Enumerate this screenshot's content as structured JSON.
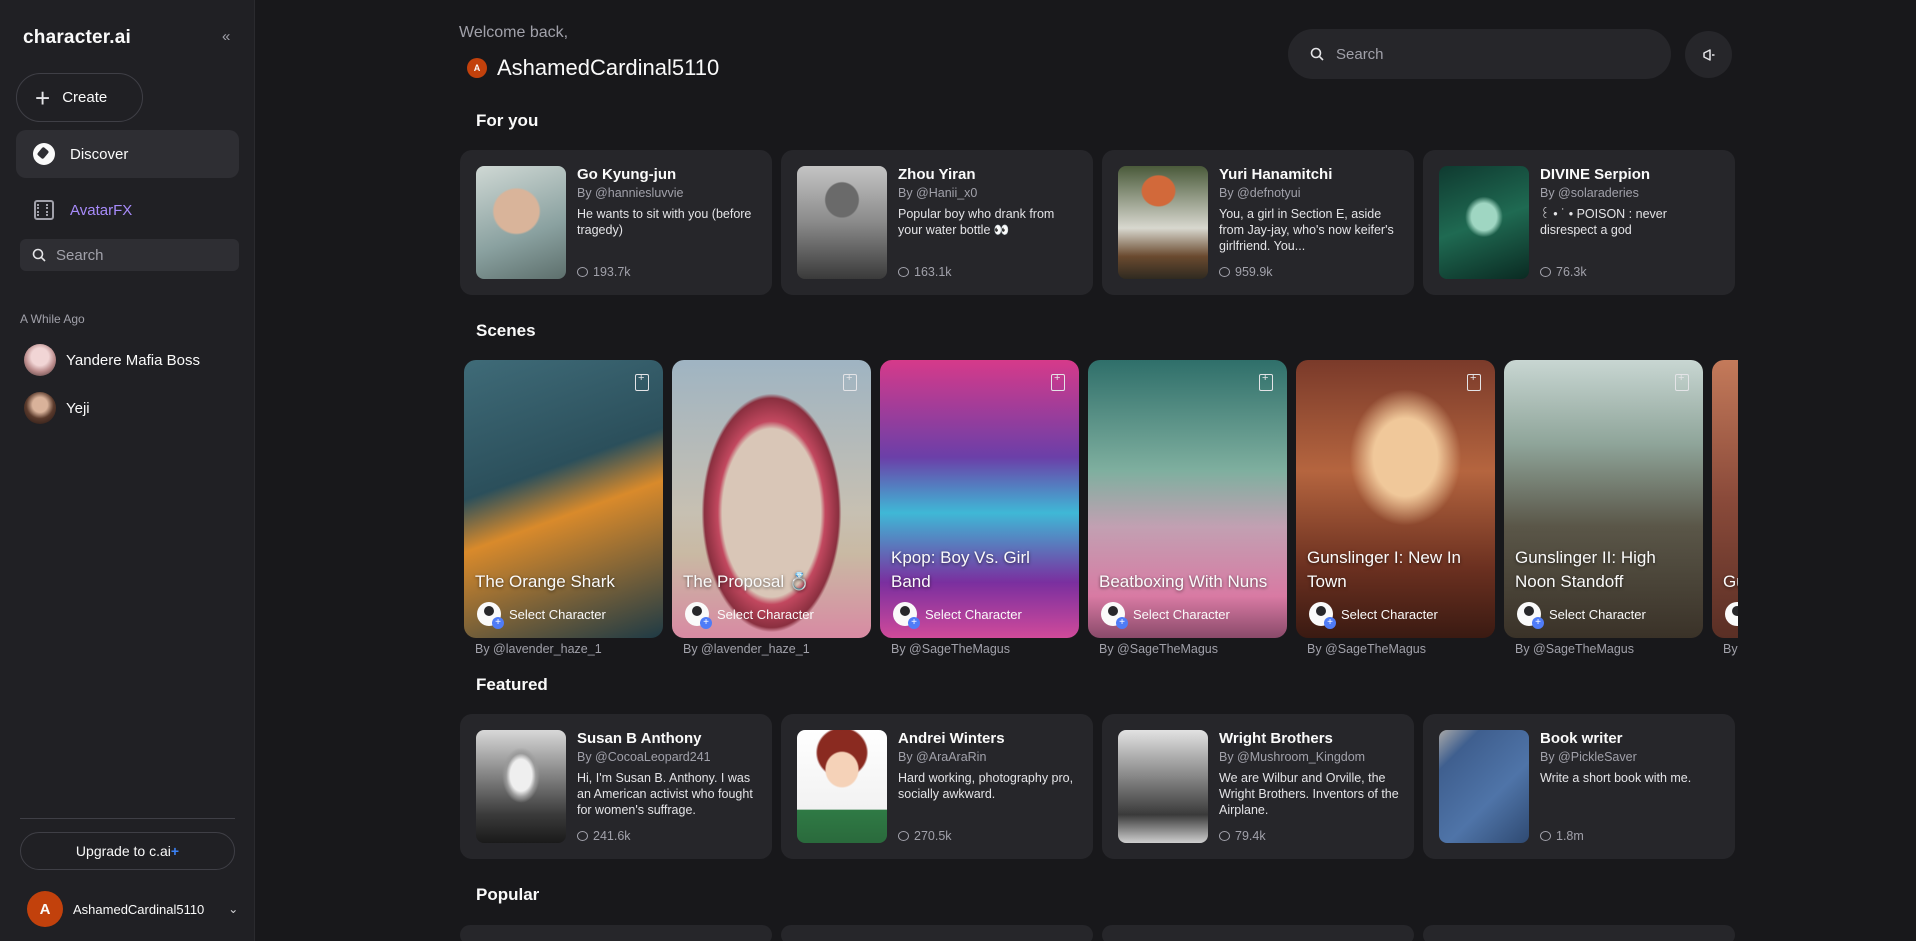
{
  "sidebar": {
    "logo": "character.ai",
    "collapse_icon": "chevrons-left-icon",
    "create_label": "Create",
    "nav": [
      {
        "label": "Discover",
        "icon": "compass-icon",
        "active": true
      },
      {
        "label": "AvatarFX",
        "icon": "film-icon",
        "color": "#a78bfa"
      }
    ],
    "search_placeholder": "Search",
    "section_label": "A While Ago",
    "recent_chats": [
      {
        "name": "Yandere Mafia Boss"
      },
      {
        "name": "Yeji"
      }
    ],
    "upgrade_label": "Upgrade to c.ai",
    "upgrade_plus": "+",
    "user": {
      "initial": "A",
      "name": "AshamedCardinal5110"
    }
  },
  "header": {
    "welcome": "Welcome back,",
    "avatar_initial": "A",
    "username": "AshamedCardinal5110",
    "search_placeholder": "Search",
    "notification_icon": "megaphone-icon"
  },
  "sections": {
    "for_you": "For you",
    "scenes": "Scenes",
    "featured": "Featured",
    "popular": "Popular"
  },
  "for_you": [
    {
      "name": "Go Kyung-jun",
      "by": "By @hanniesluvvie",
      "desc": "He wants to sit with you (before tragedy)",
      "count": "193.7k"
    },
    {
      "name": "Zhou Yiran",
      "by": "By @Hanii_x0",
      "desc": "Popular boy who drank from your water bottle 👀",
      "count": "163.1k"
    },
    {
      "name": "Yuri Hanamitchi",
      "by": "By @defnotyui",
      "desc": "You, a girl in Section E, aside from Jay-jay, who's now keifer's girlfriend. You...",
      "count": "959.9k"
    },
    {
      "name": "DIVINE Serpion",
      "by": "By @solaraderies",
      "desc": "꒰ • ˙ • POISON : never disrespect a god",
      "count": "76.3k"
    }
  ],
  "scenes": [
    {
      "title": "The Orange Shark",
      "by": "By @lavender_haze_1",
      "select": "Select Character"
    },
    {
      "title": "The Proposal 💍",
      "by": "By @lavender_haze_1",
      "select": "Select Character"
    },
    {
      "title": "Kpop: Boy Vs. Girl Band",
      "by": "By @SageTheMagus",
      "select": "Select Character"
    },
    {
      "title": "Beatboxing With Nuns",
      "by": "By @SageTheMagus",
      "select": "Select Character"
    },
    {
      "title": "Gunslinger I: New In Town",
      "by": "By @SageTheMagus",
      "select": "Select Character"
    },
    {
      "title": "Gunslinger II: High Noon Standoff",
      "by": "By @SageTheMagus",
      "select": "Select Character"
    },
    {
      "title": "Gu Ca",
      "by": "By",
      "select": ""
    }
  ],
  "featured": [
    {
      "name": "Susan B Anthony",
      "by": "By @CocoaLeopard241",
      "desc": "Hi, I'm Susan B. Anthony. I was an American activist who fought for women's suffrage.",
      "count": "241.6k"
    },
    {
      "name": "Andrei Winters",
      "by": "By @AraAraRin",
      "desc": "Hard working, photography pro, socially awkward.",
      "count": "270.5k"
    },
    {
      "name": "Wright Brothers",
      "by": "By @Mushroom_Kingdom",
      "desc": "We are Wilbur and Orville, the Wright Brothers. Inventors of the Airplane.",
      "count": "79.4k"
    },
    {
      "name": "Book writer",
      "by": "By @PickleSaver",
      "desc": "Write a short book with me.",
      "count": "1.8m"
    }
  ]
}
